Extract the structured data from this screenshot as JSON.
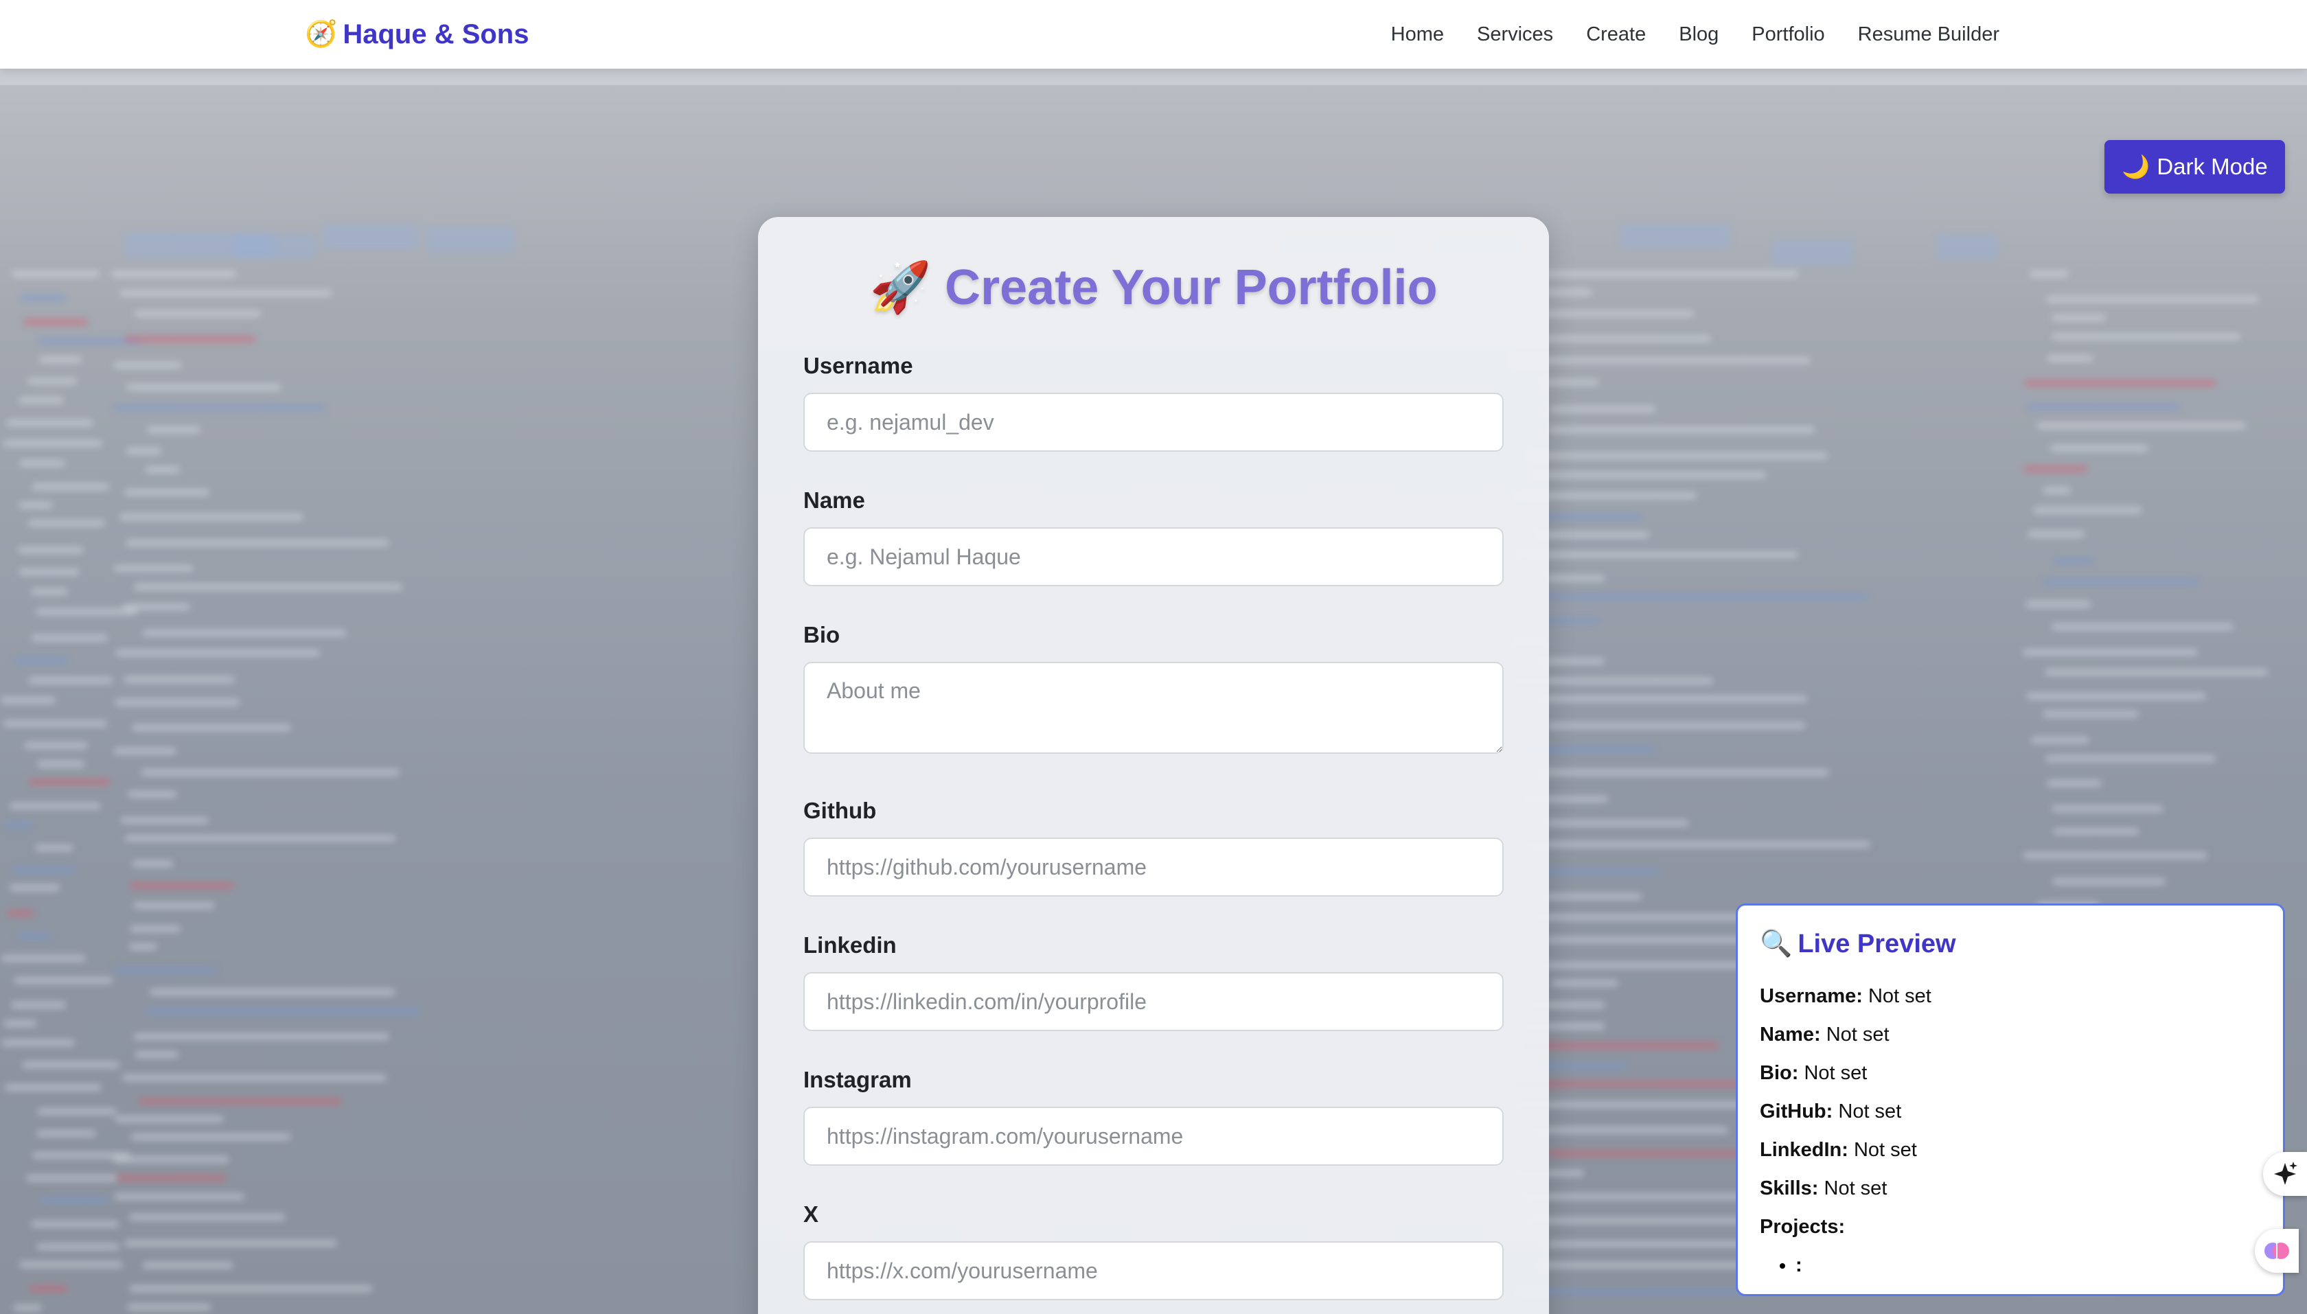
{
  "navbar": {
    "brand_icon": "🧭",
    "brand_name": "Haque & Sons",
    "links": [
      "Home",
      "Services",
      "Create",
      "Blog",
      "Portfolio",
      "Resume Builder"
    ]
  },
  "dark_mode": {
    "icon": "🌙",
    "label": "Dark Mode"
  },
  "form": {
    "title_icon": "🚀",
    "title": "Create Your Portfolio",
    "fields": [
      {
        "label": "Username",
        "placeholder": "e.g. nejamul_dev"
      },
      {
        "label": "Name",
        "placeholder": "e.g. Nejamul Haque"
      },
      {
        "label": "Bio",
        "placeholder": "About me"
      },
      {
        "label": "Github",
        "placeholder": "https://github.com/yourusername"
      },
      {
        "label": "Linkedin",
        "placeholder": "https://linkedin.com/in/yourprofile"
      },
      {
        "label": "Instagram",
        "placeholder": "https://instagram.com/yourusername"
      },
      {
        "label": "X",
        "placeholder": "https://x.com/yourusername"
      }
    ]
  },
  "preview": {
    "icon": "🔍",
    "title": "Live Preview",
    "rows": [
      {
        "key": "Username:",
        "value": "Not set"
      },
      {
        "key": "Name:",
        "value": "Not set"
      },
      {
        "key": "Bio:",
        "value": "Not set"
      },
      {
        "key": "GitHub:",
        "value": "Not set"
      },
      {
        "key": "LinkedIn:",
        "value": "Not set"
      },
      {
        "key": "Skills:",
        "value": "Not set"
      }
    ],
    "projects_label": "Projects:",
    "projects": [
      ":"
    ]
  },
  "side_icons": [
    "sparkle-icon",
    "brain-icon"
  ]
}
